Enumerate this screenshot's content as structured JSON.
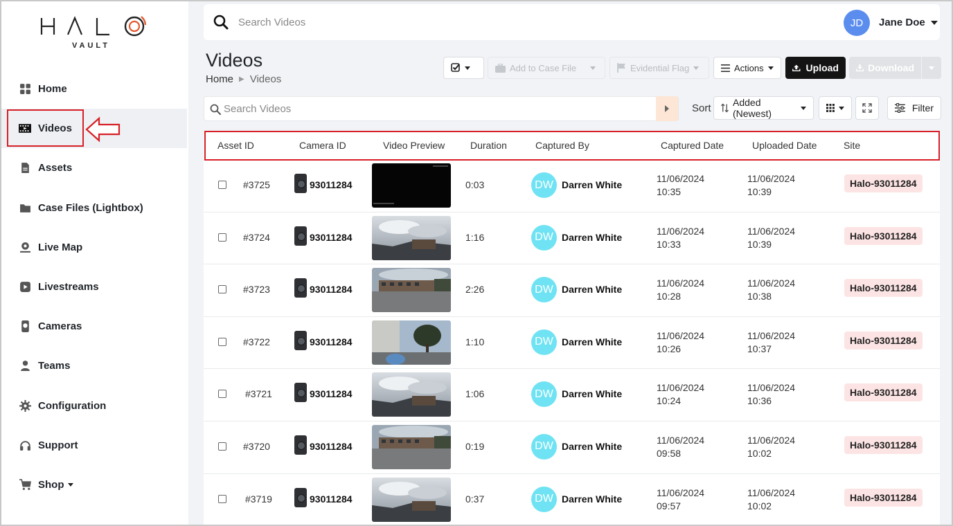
{
  "brand": {
    "logo_text": "HALO",
    "logo_sub": "VAULT"
  },
  "sidebar": {
    "items": [
      {
        "label": "Home",
        "icon": "grid-icon"
      },
      {
        "label": "Videos",
        "icon": "film-icon",
        "active": true
      },
      {
        "label": "Assets",
        "icon": "file-icon"
      },
      {
        "label": "Case Files (Lightbox)",
        "icon": "folder-icon"
      },
      {
        "label": "Live Map",
        "icon": "map-pin-icon"
      },
      {
        "label": "Livestreams",
        "icon": "play-icon"
      },
      {
        "label": "Cameras",
        "icon": "bodycam-icon"
      },
      {
        "label": "Teams",
        "icon": "user-icon"
      },
      {
        "label": "Configuration",
        "icon": "gear-icon"
      },
      {
        "label": "Support",
        "icon": "headset-icon"
      },
      {
        "label": "Shop",
        "icon": "cart-icon"
      }
    ]
  },
  "topbar": {
    "search_placeholder": "Search Videos",
    "user_initials": "JD",
    "user_name": "Jane Doe"
  },
  "page": {
    "title": "Videos",
    "breadcrumb_home": "Home",
    "breadcrumb_current": "Videos"
  },
  "toolbar": {
    "add_to_case": "Add to Case File",
    "evidential_flag": "Evidential Flag",
    "actions": "Actions",
    "upload": "Upload",
    "download": "Download"
  },
  "filters": {
    "search_placeholder": "Search Videos",
    "sort_label": "Sort",
    "sort_value": "Added (Newest)",
    "filter_label": "Filter"
  },
  "table": {
    "columns": [
      "Asset ID",
      "Camera ID",
      "Video Preview",
      "Duration",
      "Captured By",
      "Captured Date",
      "Uploaded Date",
      "Site"
    ],
    "rows": [
      {
        "asset": "#3725",
        "camera": "93011284",
        "duration": "0:03",
        "initials": "DW",
        "by": "Darren White",
        "cap_date": "11/06/2024",
        "cap_time": "10:35",
        "up_date": "11/06/2024",
        "up_time": "10:39",
        "site": "Halo-93011284",
        "preview": "dark"
      },
      {
        "asset": "#3724",
        "camera": "93011284",
        "duration": "1:16",
        "initials": "DW",
        "by": "Darren White",
        "cap_date": "11/06/2024",
        "cap_time": "10:33",
        "up_date": "11/06/2024",
        "up_time": "10:39",
        "site": "Halo-93011284",
        "preview": "sky"
      },
      {
        "asset": "#3723",
        "camera": "93011284",
        "duration": "2:26",
        "initials": "DW",
        "by": "Darren White",
        "cap_date": "11/06/2024",
        "cap_time": "10:28",
        "up_date": "11/06/2024",
        "up_time": "10:38",
        "site": "Halo-93011284",
        "preview": "building"
      },
      {
        "asset": "#3722",
        "camera": "93011284",
        "duration": "1:10",
        "initials": "DW",
        "by": "Darren White",
        "cap_date": "11/06/2024",
        "cap_time": "10:26",
        "up_date": "11/06/2024",
        "up_time": "10:37",
        "site": "Halo-93011284",
        "preview": "tree"
      },
      {
        "asset": "#3721",
        "camera": "93011284",
        "duration": "1:06",
        "initials": "DW",
        "by": "Darren White",
        "cap_date": "11/06/2024",
        "cap_time": "10:24",
        "up_date": "11/06/2024",
        "up_time": "10:36",
        "site": "Halo-93011284",
        "preview": "sky"
      },
      {
        "asset": "#3720",
        "camera": "93011284",
        "duration": "0:19",
        "initials": "DW",
        "by": "Darren White",
        "cap_date": "11/06/2024",
        "cap_time": "09:58",
        "up_date": "11/06/2024",
        "up_time": "10:02",
        "site": "Halo-93011284",
        "preview": "building"
      },
      {
        "asset": "#3719",
        "camera": "93011284",
        "duration": "0:37",
        "initials": "DW",
        "by": "Darren White",
        "cap_date": "11/06/2024",
        "cap_time": "09:57",
        "up_date": "11/06/2024",
        "up_time": "10:02",
        "site": "Halo-93011284",
        "preview": "sky"
      }
    ]
  },
  "colors": {
    "highlight": "#d61f26",
    "avatar": "#5b8def",
    "captured_by_avatar": "#6fe3f3",
    "site_badge": "#fde4e4",
    "upload_button": "#141414"
  }
}
